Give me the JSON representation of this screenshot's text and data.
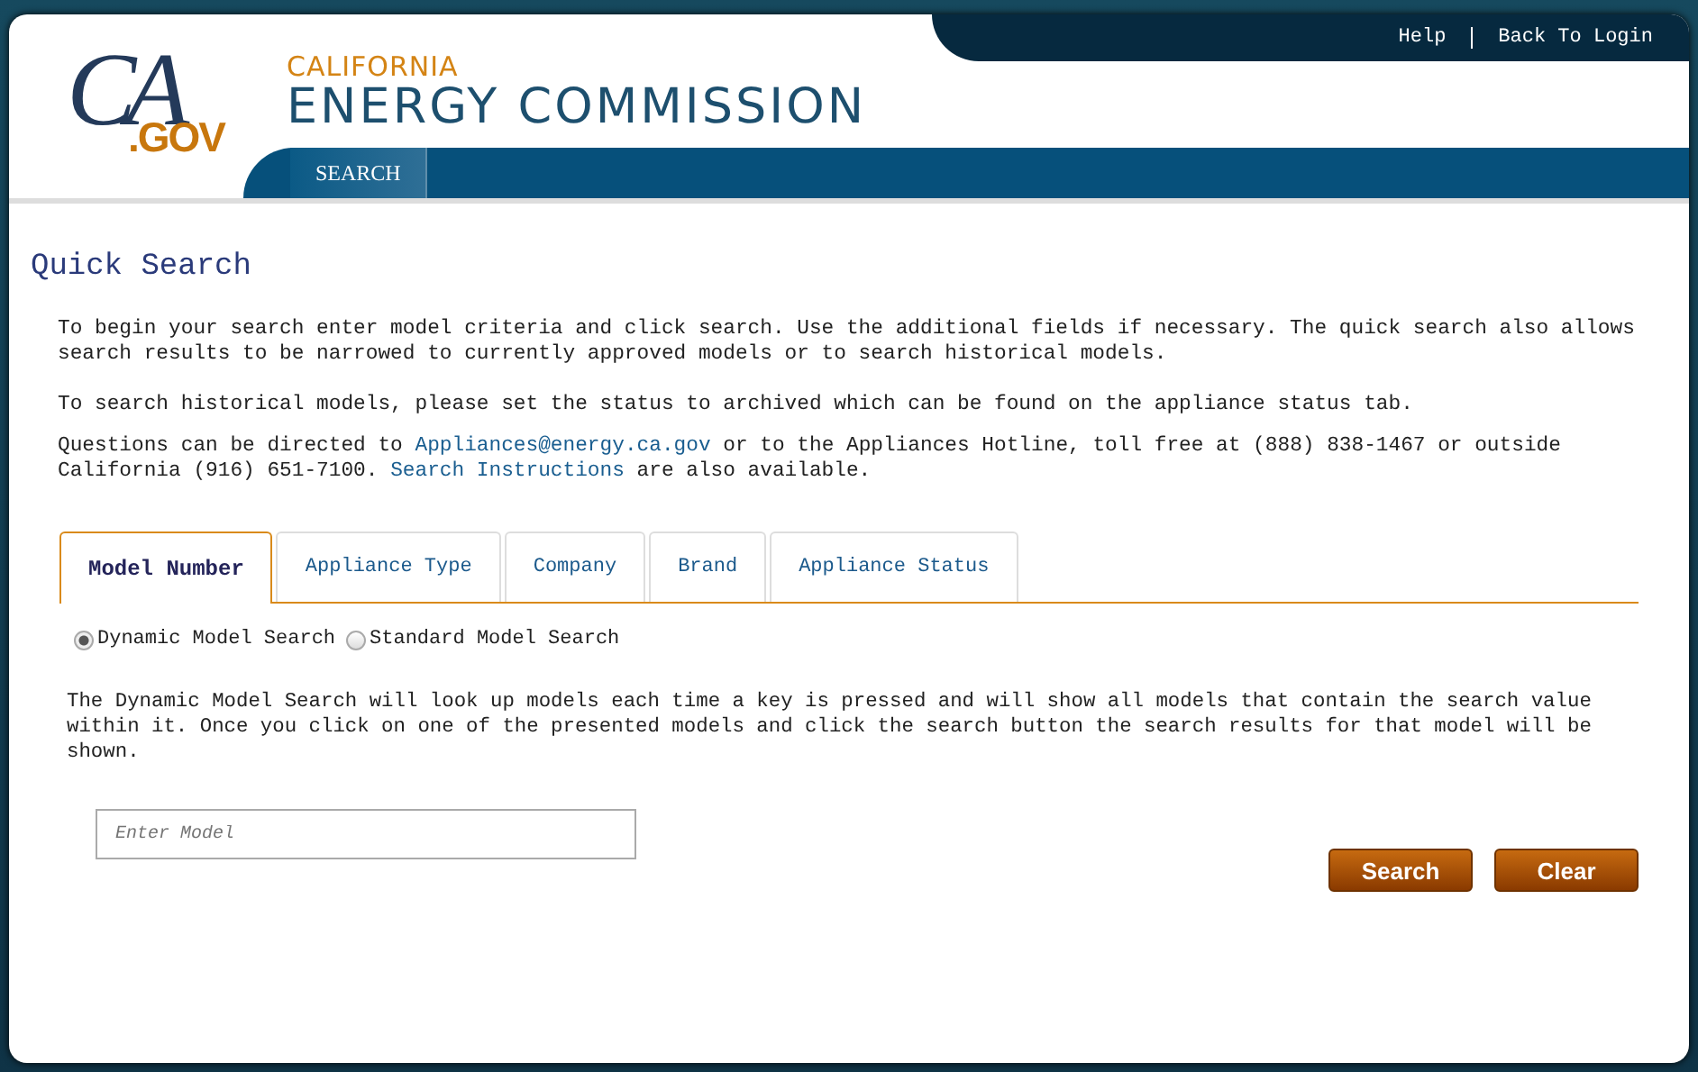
{
  "header": {
    "logo": {
      "ca": "CA",
      "gov": ".GOV"
    },
    "agency_top": "CALIFORNIA",
    "agency_name": "ENERGY COMMISSION",
    "top_links": [
      {
        "label": "Help"
      },
      {
        "label": "Back To Login"
      }
    ],
    "nav": [
      {
        "label": "SEARCH",
        "selected": true
      }
    ]
  },
  "page_title": "Quick Search",
  "paragraphs": [
    {
      "text": "To begin your search enter model criteria and click search. Use the additional fields if necessary. The quick search also allows search results to be narrowed to currently approved models or to search historical models."
    },
    {
      "text": "To search historical models, please set the status to archived which can be found on the appliance status tab."
    },
    {
      "parts": [
        {
          "text": "Questions can be directed to "
        },
        {
          "link": "Appliances@energy.ca.gov"
        },
        {
          "text": " or to the Appliances Hotline, toll free at (888) 838-1467 or outside California (916) 651-7100. "
        },
        {
          "link": "Search Instructions"
        },
        {
          "text": " are also available."
        }
      ]
    }
  ],
  "tabs": [
    {
      "label": "Model Number",
      "selected": true
    },
    {
      "label": "Appliance Type",
      "selected": false
    },
    {
      "label": "Company",
      "selected": false
    },
    {
      "label": "Brand",
      "selected": false
    },
    {
      "label": "Appliance Status",
      "selected": false
    }
  ],
  "search_modes": [
    {
      "label": "Dynamic Model Search",
      "selected": true
    },
    {
      "label": "Standard Model Search",
      "selected": false
    }
  ],
  "description": "The Dynamic Model Search will look up models each time a key is pressed and will show all models that contain the search value within it. Once you click on one of the presented models and click the search button the search results for that model will be shown.",
  "model_field": {
    "placeholder": "Enter Model"
  },
  "buttons": [
    {
      "label": "Search"
    },
    {
      "label": "Clear"
    }
  ]
}
